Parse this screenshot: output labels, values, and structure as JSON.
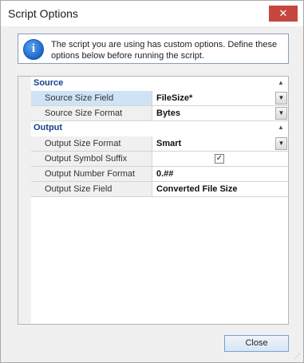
{
  "window": {
    "title": "Script Options",
    "close_glyph": "✕"
  },
  "info": {
    "icon": "info-icon",
    "icon_glyph": "i",
    "message": "The script you are using has custom options. Define these options below before running the script."
  },
  "grid": {
    "categories": [
      {
        "label": "Source",
        "properties": [
          {
            "name": "Source Size Field",
            "value": "FileSize*",
            "editor": "dropdown",
            "selected": true
          },
          {
            "name": "Source Size Format",
            "value": "Bytes",
            "editor": "dropdown",
            "selected": false
          }
        ]
      },
      {
        "label": "Output",
        "properties": [
          {
            "name": "Output Size Format",
            "value": "Smart",
            "editor": "dropdown",
            "selected": false
          },
          {
            "name": "Output Symbol Suffix",
            "value": "",
            "editor": "checkbox",
            "checked": true,
            "selected": false
          },
          {
            "name": "Output Number Format",
            "value": "0.##",
            "editor": "text",
            "selected": false
          },
          {
            "name": "Output Size Field",
            "value": "Converted File Size",
            "editor": "text",
            "selected": false
          }
        ]
      }
    ],
    "collapse_glyph": "▲",
    "dropdown_glyph": "▼",
    "check_glyph": "✓"
  },
  "buttons": {
    "close_label": "Close"
  },
  "colors": {
    "category_text": "#15428b",
    "selected_row": "#cfe3f7",
    "close_window_button": "#c7463f"
  }
}
